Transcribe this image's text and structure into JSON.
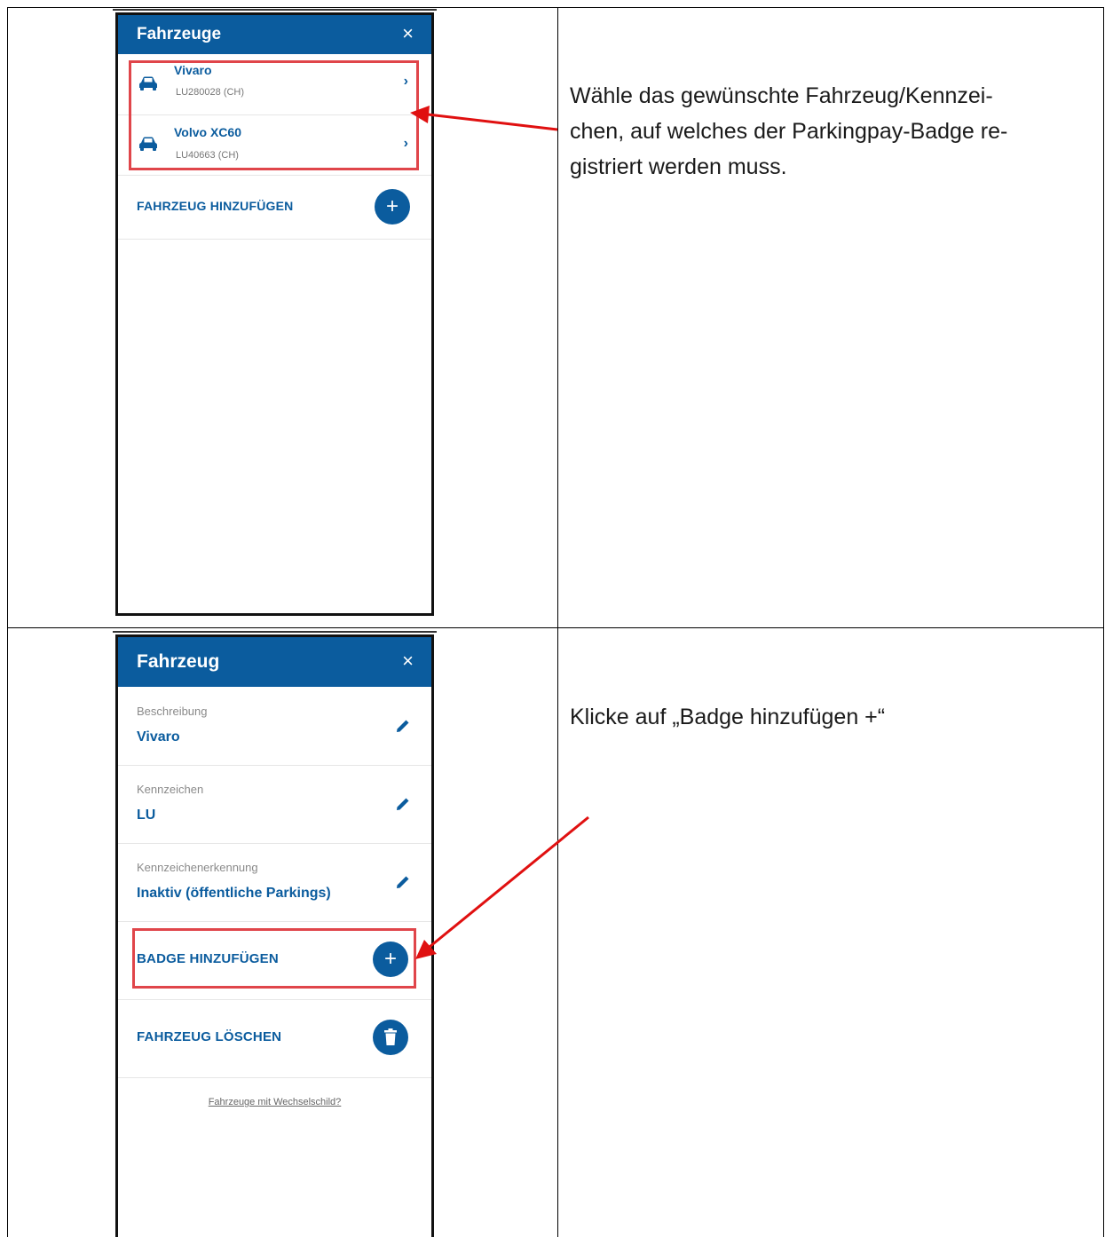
{
  "steps": [
    {
      "instruction_lines": [
        "Wähle das gewünschte Fahrzeug/Kennzei-",
        "chen, auf welches der Parkingpay-Badge re-",
        "gistriert werden muss."
      ],
      "screen": {
        "title": "Fahrzeuge",
        "close_icon": "×",
        "vehicles": [
          {
            "name": "Vivaro",
            "plate": "LU280028 (CH)"
          },
          {
            "name": "Volvo XC60",
            "plate": "LU40663 (CH)"
          }
        ],
        "add_vehicle_label": "FAHRZEUG HINZUFÜGEN"
      }
    },
    {
      "instruction_lines": [
        "Klicke auf „Badge hinzufügen +“"
      ],
      "screen": {
        "title": "Fahrzeug",
        "close_icon": "×",
        "fields": [
          {
            "label": "Beschreibung",
            "value": "Vivaro"
          },
          {
            "label": "Kennzeichen",
            "value": "LU"
          },
          {
            "label": "Kennzeichenerkennung",
            "value": "Inaktiv (öffentliche Parkings)"
          }
        ],
        "add_badge_label": "BADGE HINZUFÜGEN",
        "delete_vehicle_label": "FAHRZEUG LÖSCHEN",
        "footer_link": "Fahrzeuge mit Wechselschild?"
      }
    }
  ],
  "colors": {
    "app_blue": "#0b5c9e",
    "highlight_red": "#e0454a",
    "arrow_red": "#e01010"
  },
  "icons": {
    "vehicle": "car-icon",
    "open": "chevron-right-icon",
    "add": "plus-icon",
    "edit": "pencil-icon",
    "delete": "trash-icon",
    "close": "close-icon"
  }
}
